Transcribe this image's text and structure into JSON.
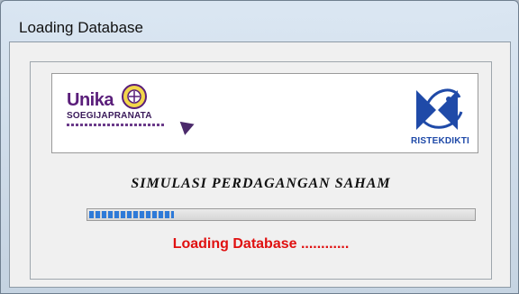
{
  "window": {
    "title": "Loading Database"
  },
  "banner": {
    "left_logo_name": "Unika",
    "left_logo_subtitle": "SOEGIJAPRANATA",
    "right_logo_label": "RISTEKDIKTI"
  },
  "app": {
    "title": "SIMULASI PERDAGANGAN SAHAM"
  },
  "progress": {
    "value_percent": 22,
    "color": "#2e7ad8"
  },
  "status": {
    "text": "Loading Database ............",
    "color": "#e01010"
  }
}
